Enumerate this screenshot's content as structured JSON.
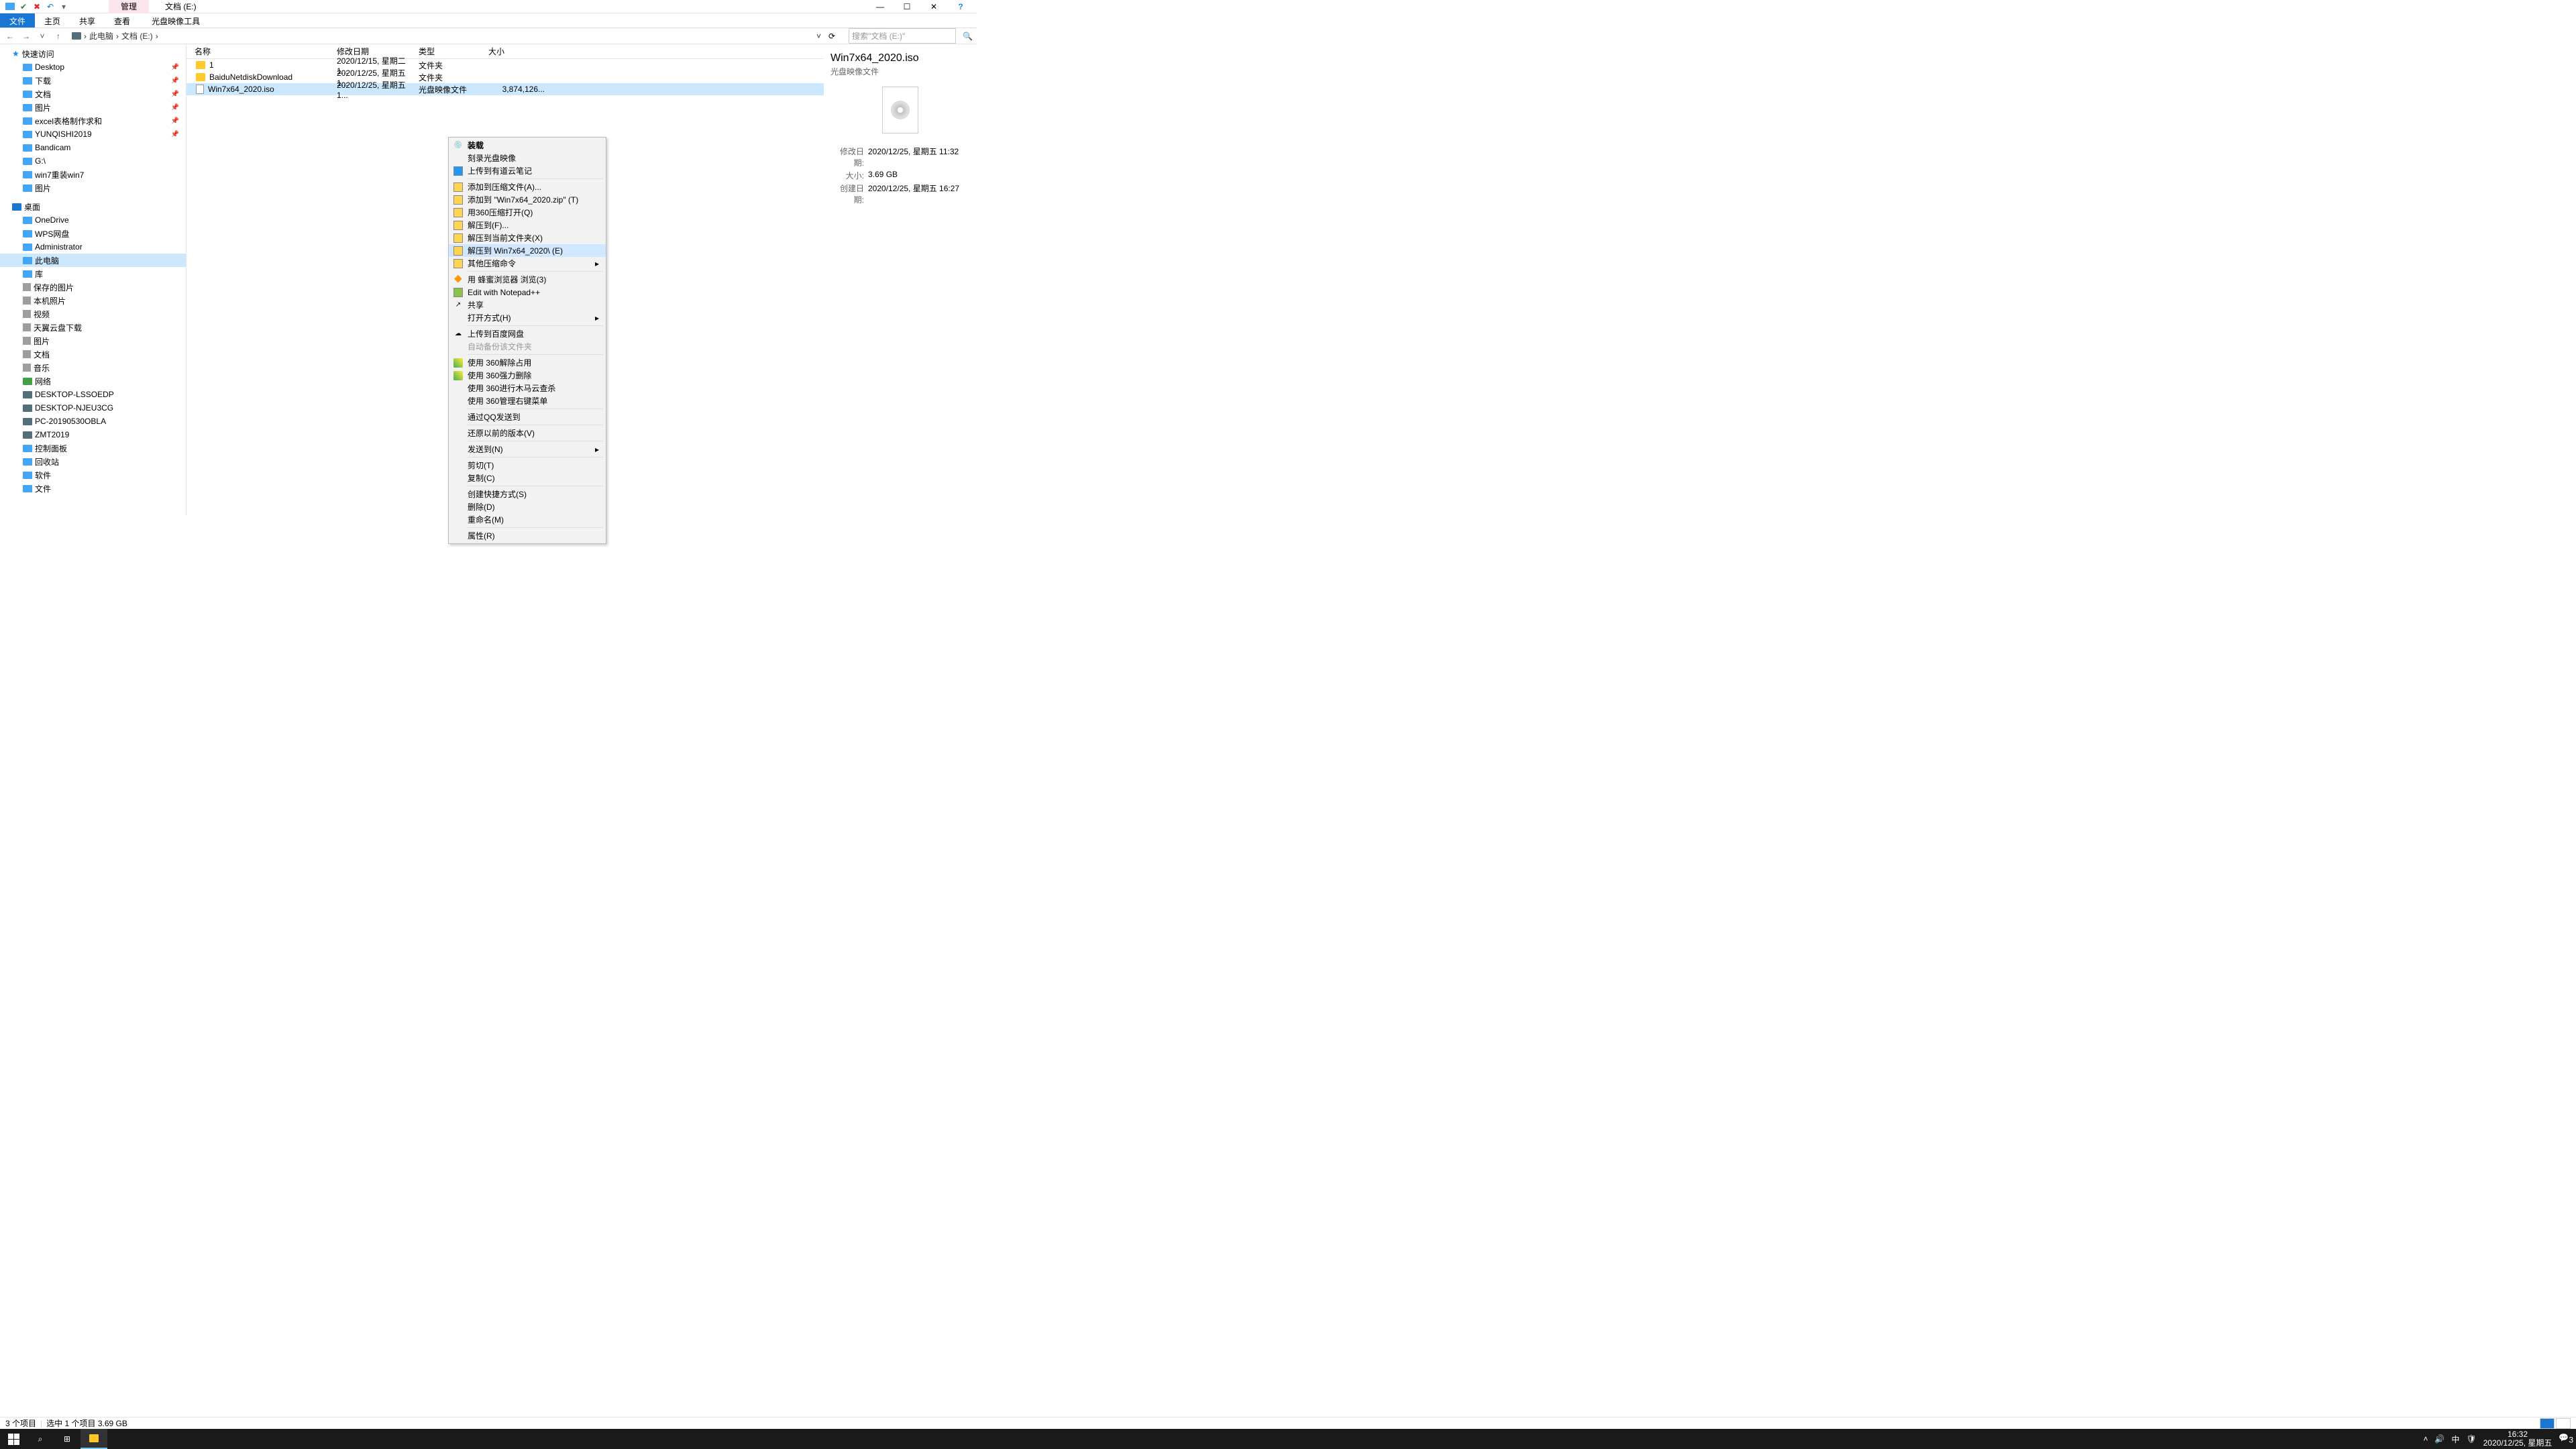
{
  "title_tab": "管理",
  "window_title": "文档 (E:)",
  "ribbon": {
    "file": "文件",
    "home": "主页",
    "share": "共享",
    "view": "查看",
    "disc_tool": "光盘映像工具"
  },
  "breadcrumb": {
    "root": "此电脑",
    "folder": "文档 (E:)"
  },
  "search_placeholder": "搜索\"文档 (E:)\"",
  "columns": {
    "name": "名称",
    "date": "修改日期",
    "type": "类型",
    "size": "大小"
  },
  "rows": [
    {
      "name": "1",
      "date": "2020/12/15, 星期二 1...",
      "type": "文件夹",
      "size": "",
      "folder": true
    },
    {
      "name": "BaiduNetdiskDownload",
      "date": "2020/12/25, 星期五 1...",
      "type": "文件夹",
      "size": "",
      "folder": true
    },
    {
      "name": "Win7x64_2020.iso",
      "date": "2020/12/25, 星期五 1...",
      "type": "光盘映像文件",
      "size": "3,874,126...",
      "folder": false,
      "selected": true
    }
  ],
  "tree": {
    "quick": "快速访问",
    "quick_items": [
      "Desktop",
      "下载",
      "文档",
      "图片",
      "excel表格制作求和",
      "YUNQISHI2019",
      "Bandicam",
      "G:\\",
      "win7重装win7",
      "图片"
    ],
    "desktop": "桌面",
    "desktop_items": [
      "OneDrive",
      "WPS网盘",
      "Administrator",
      "此电脑",
      "库"
    ],
    "lib_items": [
      "保存的图片",
      "本机照片",
      "视频",
      "天翼云盘下载",
      "图片",
      "文档",
      "音乐"
    ],
    "network": "网络",
    "network_items": [
      "DESKTOP-LSSOEDP",
      "DESKTOP-NJEU3CG",
      "PC-20190530OBLA",
      "ZMT2019"
    ],
    "others": [
      "控制面板",
      "回收站",
      "软件",
      "文件"
    ]
  },
  "ctx": {
    "mount": "装载",
    "burn": "刻录光盘映像",
    "upload_youdao": "上传到有道云笔记",
    "add_archive": "添加到压缩文件(A)...",
    "add_zip": "添加到 \"Win7x64_2020.zip\" (T)",
    "open_360zip": "用360压缩打开(Q)",
    "extract_to": "解压到(F)...",
    "extract_here": "解压到当前文件夹(X)",
    "extract_named": "解压到 Win7x64_2020\\ (E)",
    "other_zip": "其他压缩命令",
    "honey_browse": "用 蜂蜜浏览器 浏览(3)",
    "notepadpp": "Edit with Notepad++",
    "share": "共享",
    "open_with": "打开方式(H)",
    "upload_baidu": "上传到百度网盘",
    "auto_backup": "自动备份该文件夹",
    "use_360_unlock": "使用 360解除占用",
    "use_360_forcedel": "使用 360强力删除",
    "use_360_trojan": "使用 360进行木马云查杀",
    "use_360_menu": "使用 360管理右键菜单",
    "send_qq": "通过QQ发送到",
    "restore_prev": "还原以前的版本(V)",
    "send_to": "发送到(N)",
    "cut": "剪切(T)",
    "copy": "复制(C)",
    "shortcut": "创建快捷方式(S)",
    "delete": "删除(D)",
    "rename": "重命名(M)",
    "properties": "属性(R)"
  },
  "details": {
    "filename": "Win7x64_2020.iso",
    "filetype": "光盘映像文件",
    "modified_label": "修改日期:",
    "modified": "2020/12/25, 星期五 11:32",
    "size_label": "大小:",
    "size": "3.69 GB",
    "created_label": "创建日期:",
    "created": "2020/12/25, 星期五 16:27"
  },
  "status": {
    "count": "3 个项目",
    "selection": "选中 1 个项目  3.69 GB"
  },
  "clock": {
    "time": "16:32",
    "date": "2020/12/25, 星期五"
  },
  "tray_badge": "3"
}
